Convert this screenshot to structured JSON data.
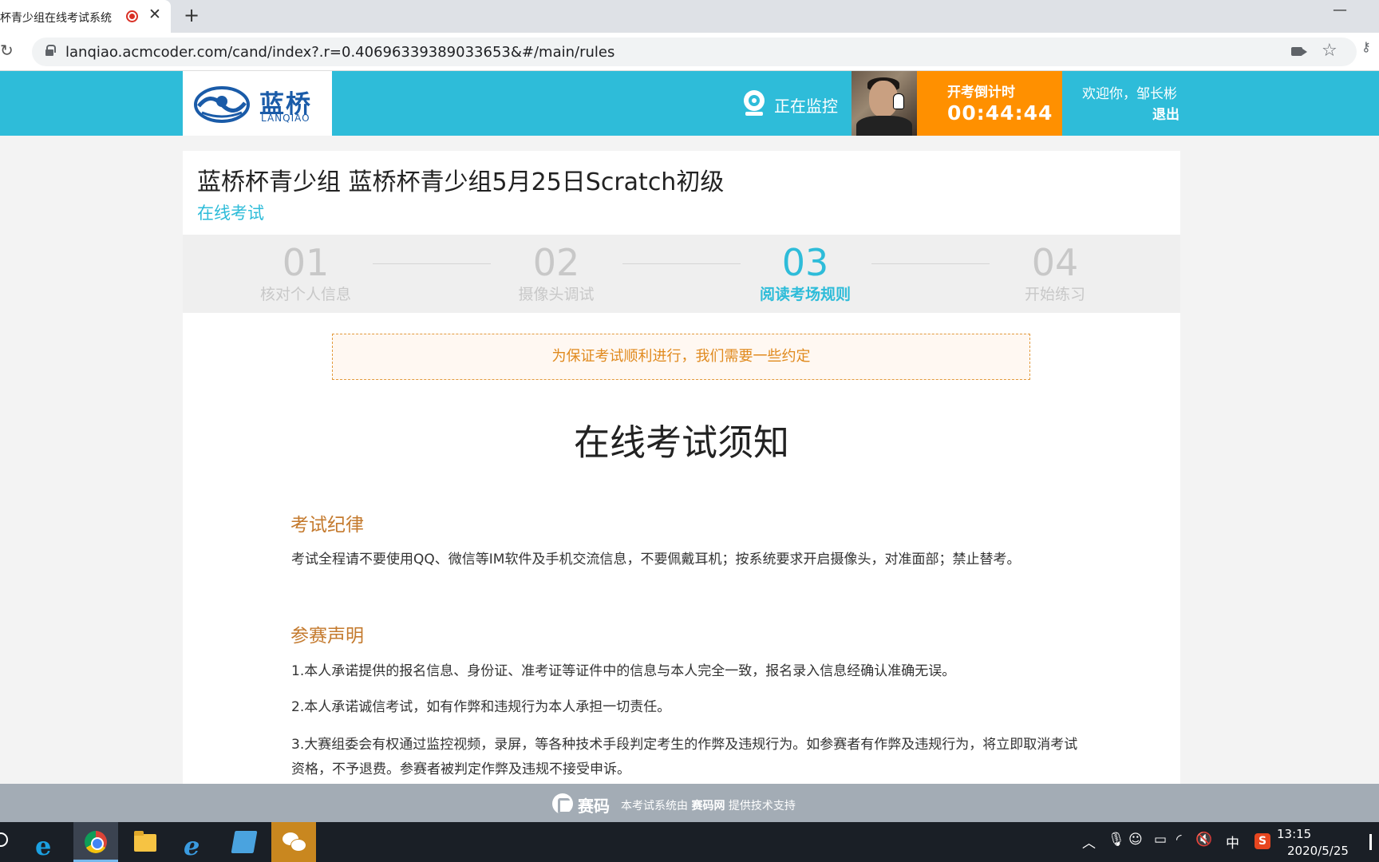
{
  "browser": {
    "tab_title": "杯青少组在线考试系统",
    "new_tab": "+",
    "url": "lanqiao.acmcoder.com/cand/index?.r=0.40696339389033653&#/main/rules"
  },
  "header": {
    "logo_cn": "蓝桥",
    "logo_en": "LANQIAO",
    "monitor_text": "正在监控",
    "countdown_label": "开考倒计时",
    "countdown_time": "00:44:44",
    "welcome": "欢迎你，邹长彬",
    "logout": "退出",
    "accent_color": "#2ebcd9",
    "countdown_color": "#ff9000"
  },
  "exam": {
    "title": "蓝桥杯青少组 蓝桥杯青少组5月25日Scratch初级",
    "subtitle": "在线考试"
  },
  "steps": [
    {
      "num": "01",
      "label": "核对个人信息"
    },
    {
      "num": "02",
      "label": "摄像头调试"
    },
    {
      "num": "03",
      "label": "阅读考场规则"
    },
    {
      "num": "04",
      "label": "开始练习"
    }
  ],
  "rules": {
    "notice": "为保证考试顺利进行，我们需要一些约定",
    "title": "在线考试须知",
    "sections": [
      {
        "heading": "考试纪律",
        "paragraphs": [
          "考试全程请不要使用QQ、微信等IM软件及手机交流信息，不要佩戴耳机；按系统要求开启摄像头，对准面部；禁止替考。"
        ]
      },
      {
        "heading": "参赛声明",
        "paragraphs": [
          "1.本人承诺提供的报名信息、身份证、准考证等证件中的信息与本人完全一致，报名录入信息经确认准确无误。",
          "2.本人承诺诚信考试，如有作弊和违规行为本人承担一切责任。",
          "3.大赛组委会有权通过监控视频，录屏，等各种技术手段判定考生的作弊及违规行为。如参赛者有作弊及违规行为，将立即取消考试资格，不予退费。参赛者被判定作弊及违规不接受申诉。"
        ]
      }
    ]
  },
  "footer": {
    "brand": "赛码",
    "text_prefix": "本考试系统由",
    "text_brand": "赛码网",
    "text_suffix": "提供技术支持"
  },
  "taskbar": {
    "ime": "中",
    "time": "13:15",
    "date": "2020/5/25"
  }
}
